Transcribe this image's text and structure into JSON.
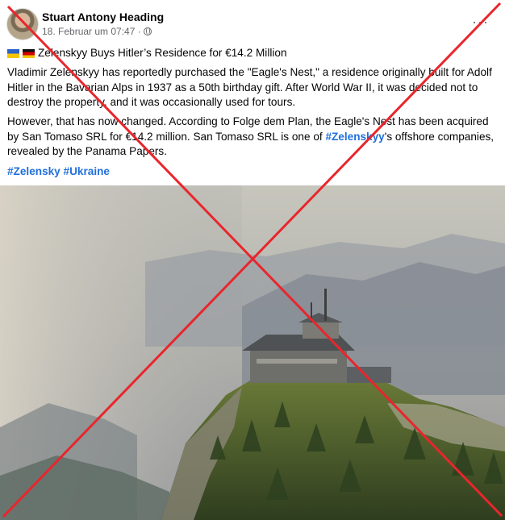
{
  "post": {
    "author": "Stuart Antony Heading",
    "timestamp": "18. Februar um 07:47 ·",
    "more_icon": "more-horizontal-icon",
    "privacy_icon": "globe-icon",
    "title": "Zelenskyy Buys Hitler’s Residence for €14.2 Million",
    "paragraph1": "Vladimir Zelenskyy has reportedly purchased the \"Eagle's Nest,\" a residence originally built for Adolf Hitler in the Bavarian Alps in 1937 as a 50th birthday gift. After World War II, it was decided not to destroy the property, and it was occasionally used for tours.",
    "paragraph2_a": "However, that has now changed. According to Folge dem Plan, the Eagle's Nest has been acquired by San Tomaso SRL for €14.2 million. San Tomaso SRL is one of ",
    "paragraph2_tag": "#Zelenskyy",
    "paragraph2_b": "'s offshore companies, revealed by the Panama Papers.",
    "hashtags": [
      "#Zelensky",
      "#Ukraine"
    ]
  },
  "overlay": {
    "cross_color": "#e8262c"
  }
}
